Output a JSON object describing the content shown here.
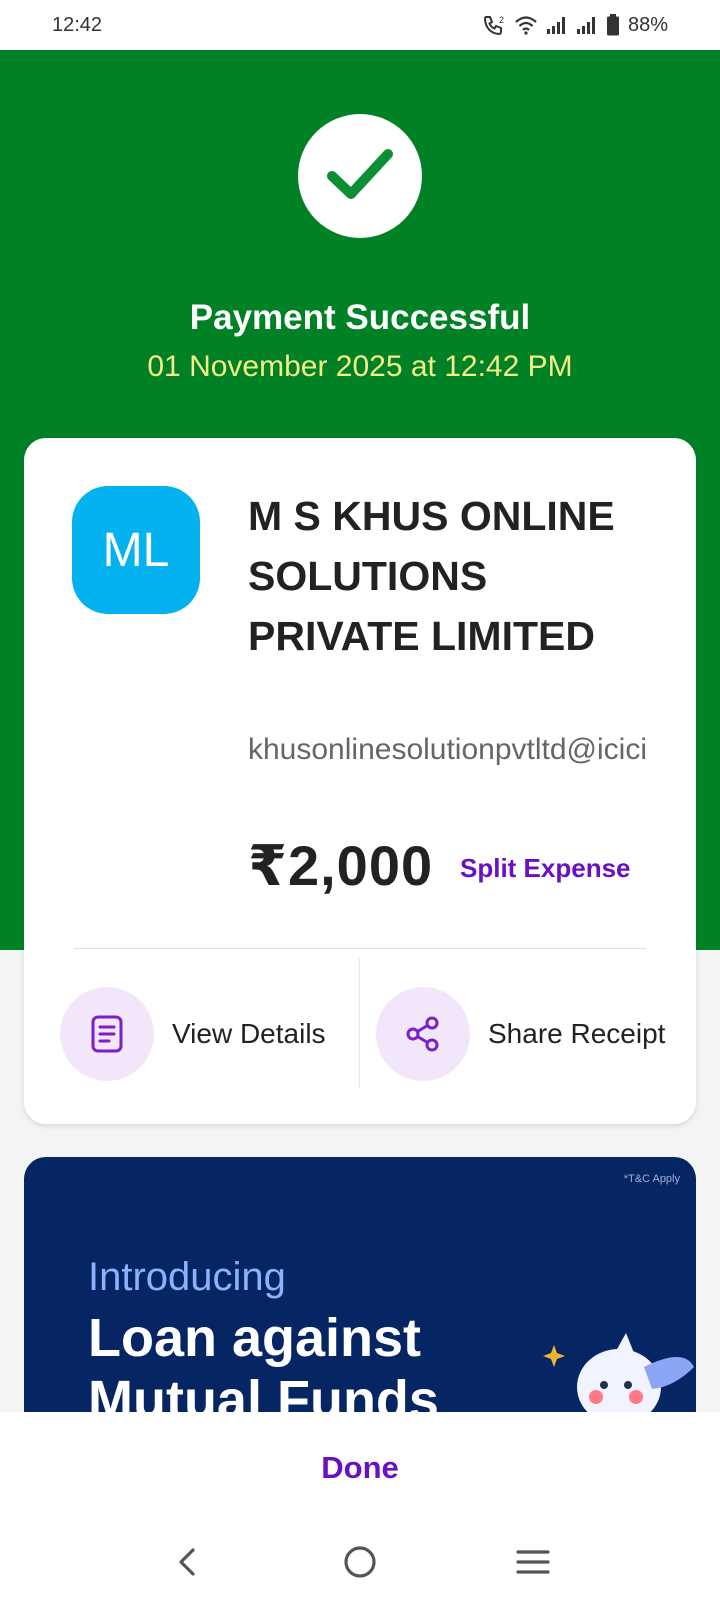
{
  "status_bar": {
    "time": "12:42",
    "battery": "88%",
    "icons": [
      "wifi-calling-icon",
      "wifi-icon",
      "signal-icon",
      "signal-icon",
      "battery-icon"
    ]
  },
  "header": {
    "status_icon": "check-icon",
    "title": "Payment Successful",
    "datetime": "01 November 2025 at 12:42 PM",
    "background_color": "#008126",
    "datetime_color": "#f3ee86"
  },
  "payment": {
    "avatar_initials": "ML",
    "avatar_color": "#03b2ee",
    "merchant_name": "M S KHUS ONLINE SOLUTIONS PRIVATE LIMITED",
    "upi_id": "khusonlinesolutionpvtltd@icici",
    "amount": "₹2,000",
    "split_expense_label": "Split Expense",
    "actions": [
      {
        "label": "View Details",
        "icon": "document-icon"
      },
      {
        "label": "Share Receipt",
        "icon": "share-icon"
      }
    ]
  },
  "promo": {
    "tnc": "*T&C Apply",
    "intro": "Introducing",
    "title": "Loan against Mutual Funds",
    "background_color": "#062563"
  },
  "footer": {
    "done_label": "Done",
    "accent_color": "#6a0fc2"
  },
  "nav": {
    "buttons": [
      "back-icon",
      "home-icon",
      "menu-icon"
    ]
  }
}
